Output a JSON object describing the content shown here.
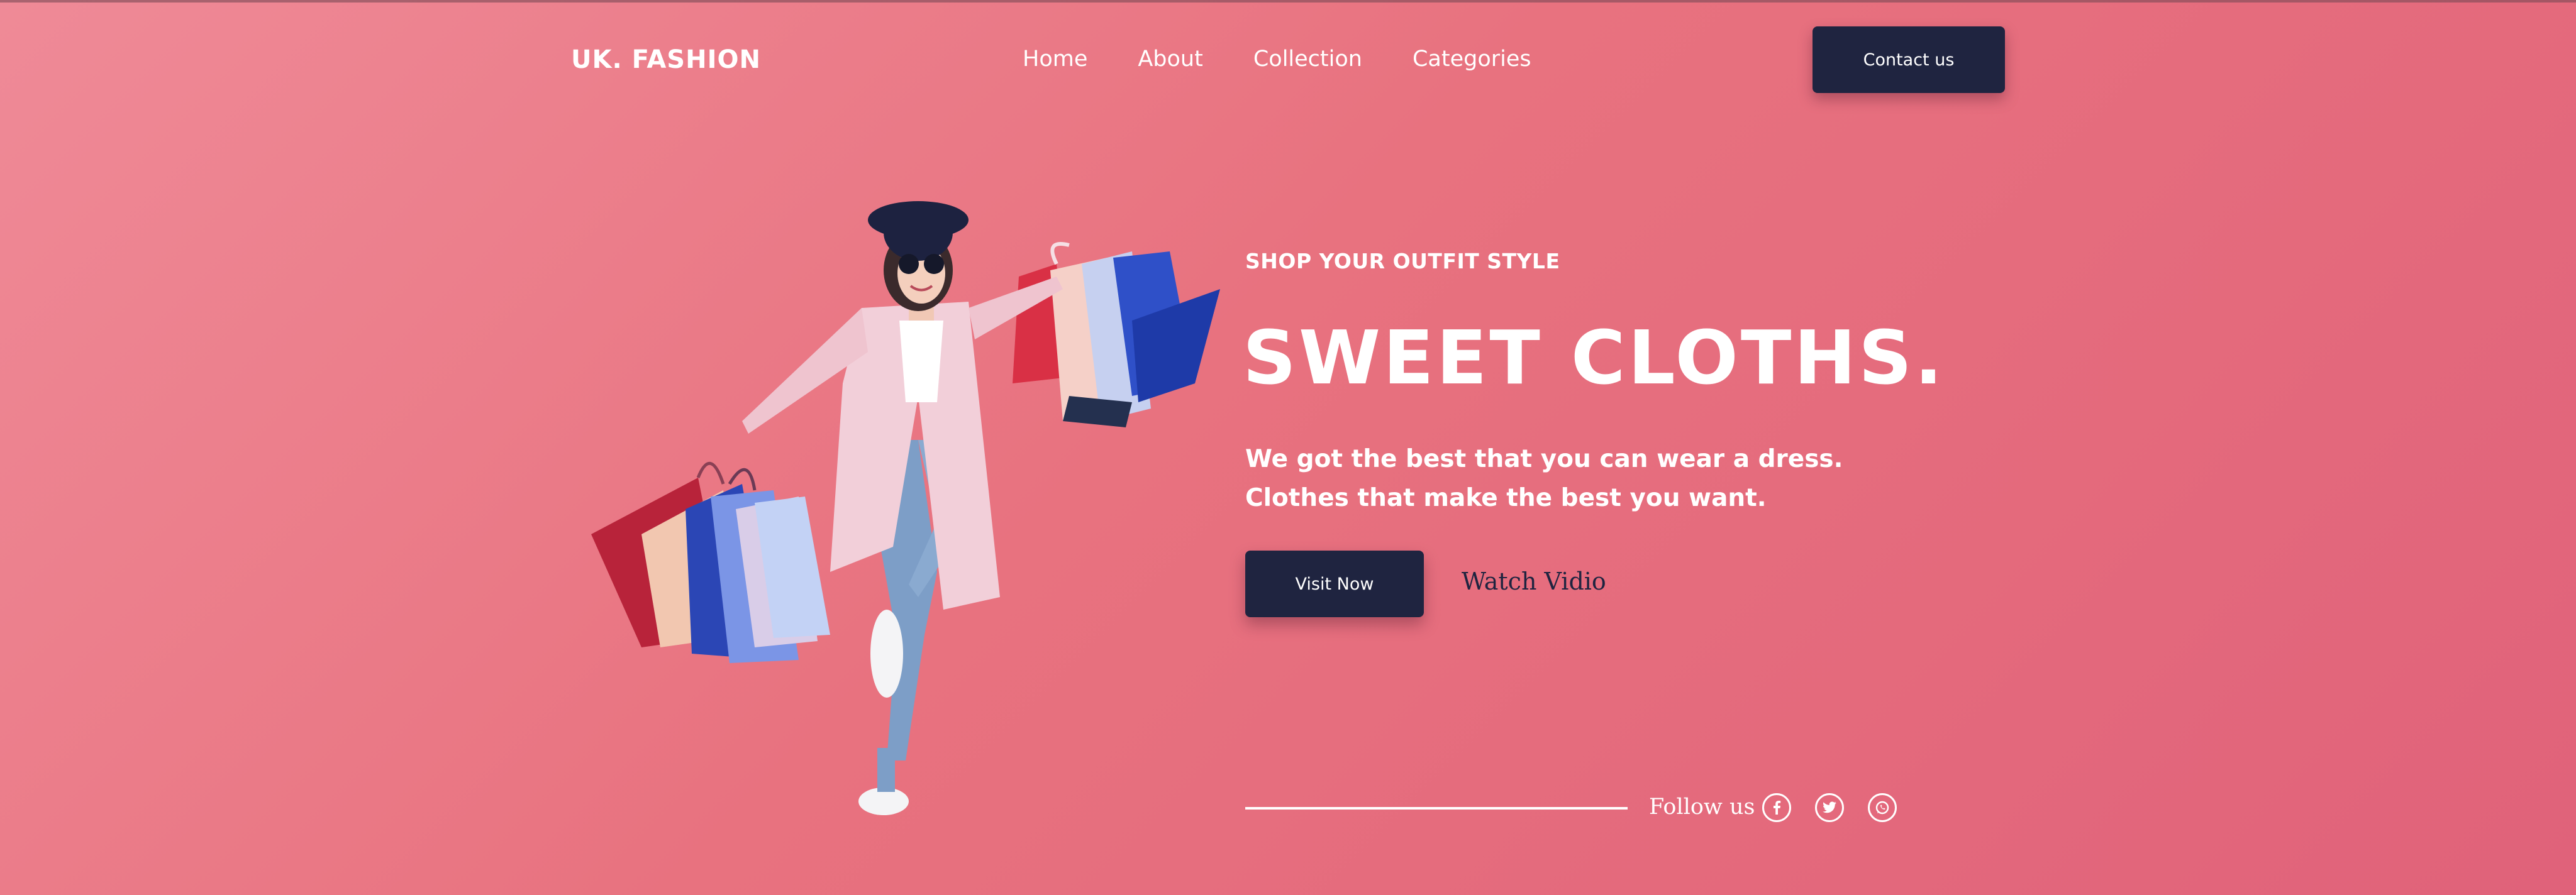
{
  "brand": {
    "logo_text": "UK. FASHION"
  },
  "nav": {
    "items": [
      {
        "label": "Home"
      },
      {
        "label": "About"
      },
      {
        "label": "Collection"
      },
      {
        "label": "Categories"
      }
    ],
    "contact_label": "Contact us"
  },
  "hero": {
    "kicker": "SHOP YOUR OUTFIT STYLE",
    "headline": "SWEET CLOTHS.",
    "description": "We got the best that you can wear a dress. Clothes that make the best you want.",
    "primary_button": "Visit Now",
    "secondary_link": "Watch Vidio",
    "image_icon": "woman-with-shopping-bags-illustration"
  },
  "follow": {
    "label": "Follow us",
    "socials": [
      {
        "icon": "facebook-icon"
      },
      {
        "icon": "twitter-icon"
      },
      {
        "icon": "whatsapp-icon"
      }
    ]
  },
  "colors": {
    "background_start": "#ef8a97",
    "background_end": "#e0627a",
    "button_dark": "#1f2440",
    "text_light": "#ffffff"
  }
}
